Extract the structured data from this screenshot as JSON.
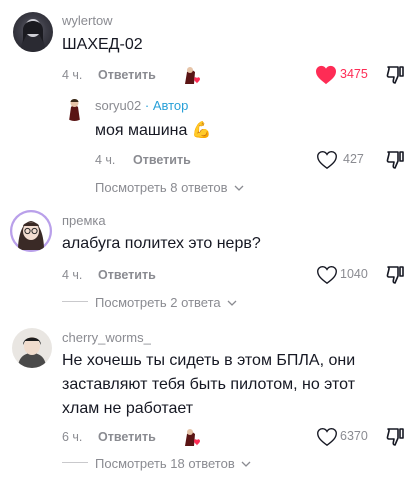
{
  "comments": [
    {
      "username": "wylertow",
      "text": "ШАХЕД-02",
      "time": "4 ч.",
      "reply_label": "Ответить",
      "likes": "3475",
      "liked": true,
      "reply": {
        "username": "soryu02",
        "author_badge": "· Автор",
        "text": "моя машина",
        "emoji": "💪",
        "time": "4 ч.",
        "reply_label": "Ответить",
        "likes": "427"
      },
      "view_replies": "Посмотреть 8 ответов"
    },
    {
      "username": "премка",
      "text": "алабуга политех это нерв?",
      "time": "4 ч.",
      "reply_label": "Ответить",
      "likes": "1040",
      "view_replies": "Посмотреть 2 ответа"
    },
    {
      "username": "cherry_worms_",
      "text_lines": [
        "Не хочешь ты сидеть в этом БПЛА, они",
        "заставляют тебя быть пилотом, но этот",
        "хлам не работает"
      ],
      "time": "6 ч.",
      "reply_label": "Ответить",
      "likes": "6370",
      "view_replies": "Посмотреть 18 ответов"
    }
  ],
  "colors": {
    "liked": "#fe2c55",
    "author_badge": "#28a0d8",
    "secondary_text": "#8a8b91",
    "primary_text": "#161823"
  }
}
